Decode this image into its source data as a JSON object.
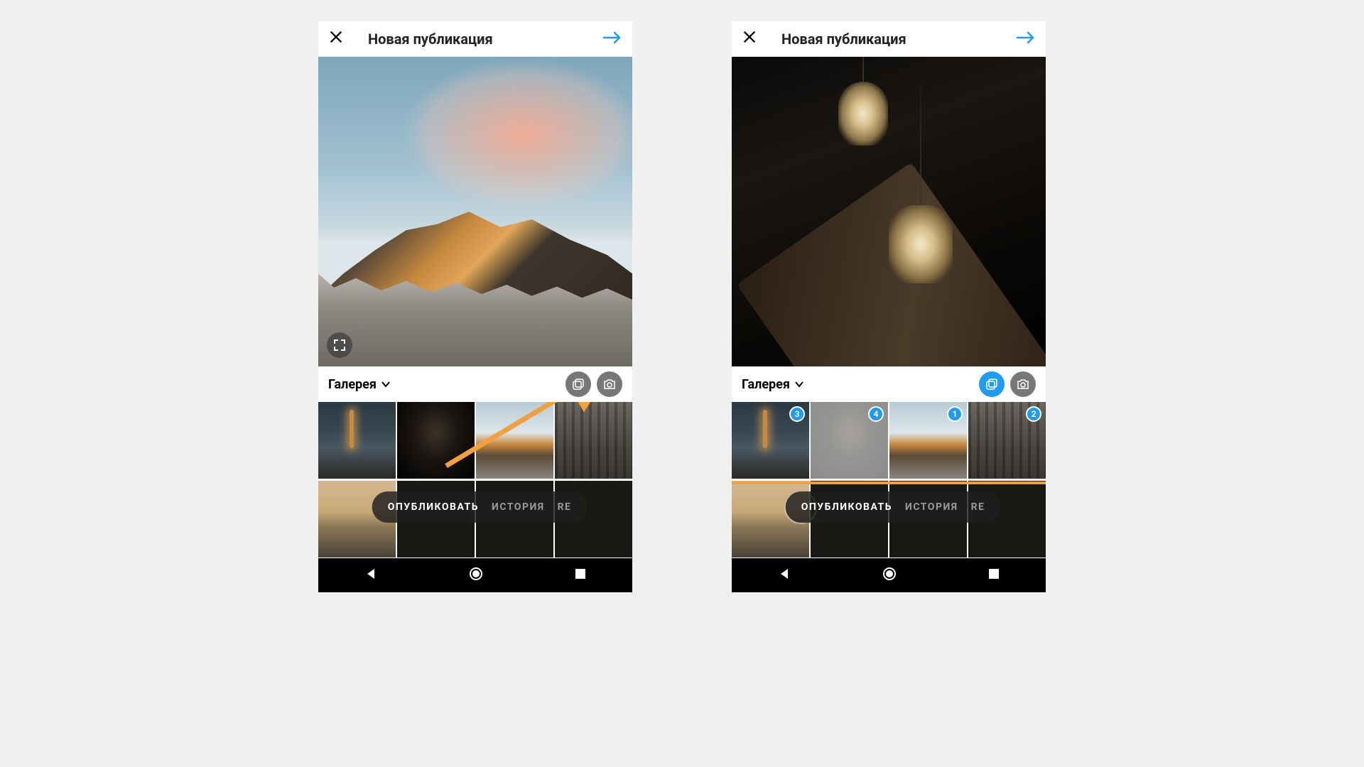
{
  "header": {
    "title": "Новая публикация"
  },
  "source": {
    "label": "Галерея"
  },
  "modes": {
    "publish": "ОПУБЛИКОВАТЬ",
    "story": "ИСТОРИЯ",
    "reels_cut": "RE"
  },
  "screen_right": {
    "multiselect_active": true,
    "thumbs": [
      {
        "order": "3"
      },
      {
        "order": "4",
        "selected": true
      },
      {
        "order": "1"
      },
      {
        "order": "2"
      }
    ]
  },
  "colors": {
    "accent": "#1f9cf0",
    "highlight": "#f0a040"
  }
}
